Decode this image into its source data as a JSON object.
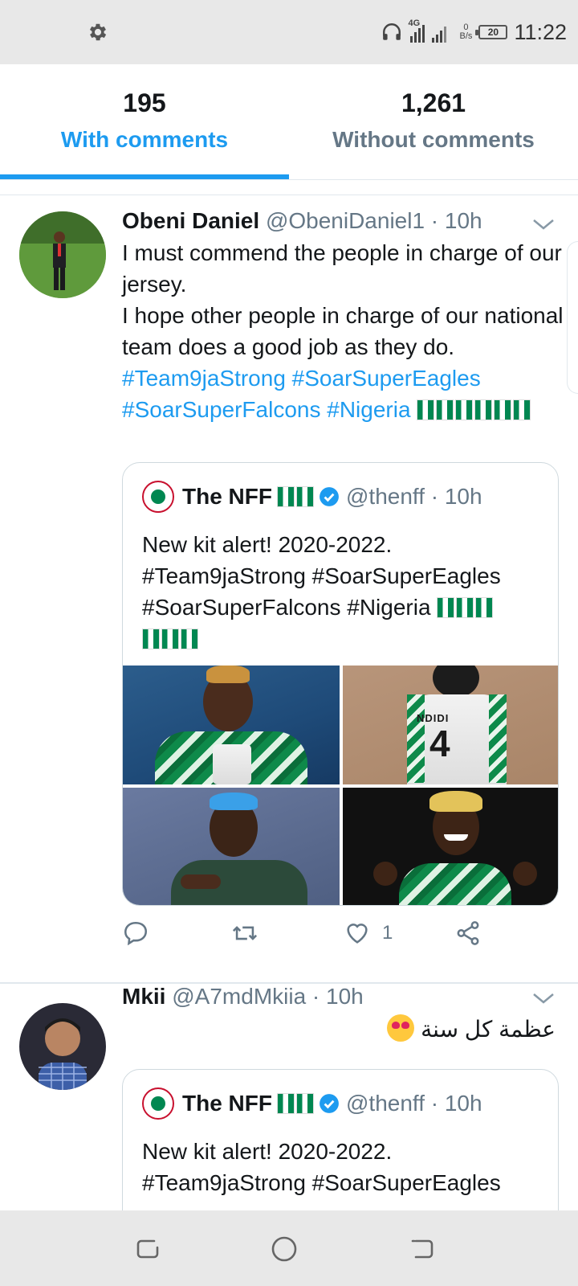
{
  "status_bar": {
    "time": "11:22",
    "network_type": "4G",
    "data_rate_value": "0",
    "data_rate_unit": "B/s",
    "battery": "20",
    "icons": [
      "gear-icon",
      "headphones-icon",
      "signal-icon",
      "battery-icon"
    ]
  },
  "tabs": [
    {
      "count": "195",
      "label": "With comments",
      "active": true
    },
    {
      "count": "1,261",
      "label": "Without comments",
      "active": false
    }
  ],
  "tweets": [
    {
      "name": "Obeni Daniel",
      "meta": "@ObeniDaniel1 · 10h",
      "text_lines": [
        "I must commend the people in charge of our jersey.",
        "I hope other people in charge of our national team does a good job as they do."
      ],
      "hashtags_line1": "#Team9jaStrong #SoarSuperEagles",
      "hashtags_line2": "#SoarSuperFalcons #Nigeria",
      "quote": {
        "name": "The NFF",
        "meta": "@thenff · 10h",
        "text": "New kit alert! 2020-2022.",
        "hashtags_line1": "#Team9jaStrong #SoarSuperEagles",
        "hashtags_line2": "#SoarSuperFalcons #Nigeria",
        "jersey_name": "NDIDI",
        "jersey_number": "4"
      },
      "actions": {
        "reply": "",
        "retweet": "",
        "like": "1",
        "share": ""
      }
    },
    {
      "name": "Mkii",
      "meta": "@A7mdMkiia · 10h",
      "text": "عظمة كل سنة",
      "quote": {
        "name": "The NFF",
        "meta": "@thenff · 10h",
        "text": "New kit alert! 2020-2022.",
        "hashtags_line1": "#Team9jaStrong #SoarSuperEagles"
      }
    }
  ],
  "colors": {
    "accent": "#1d9bf0",
    "muted": "#657786",
    "nigeria_green": "#008751"
  }
}
